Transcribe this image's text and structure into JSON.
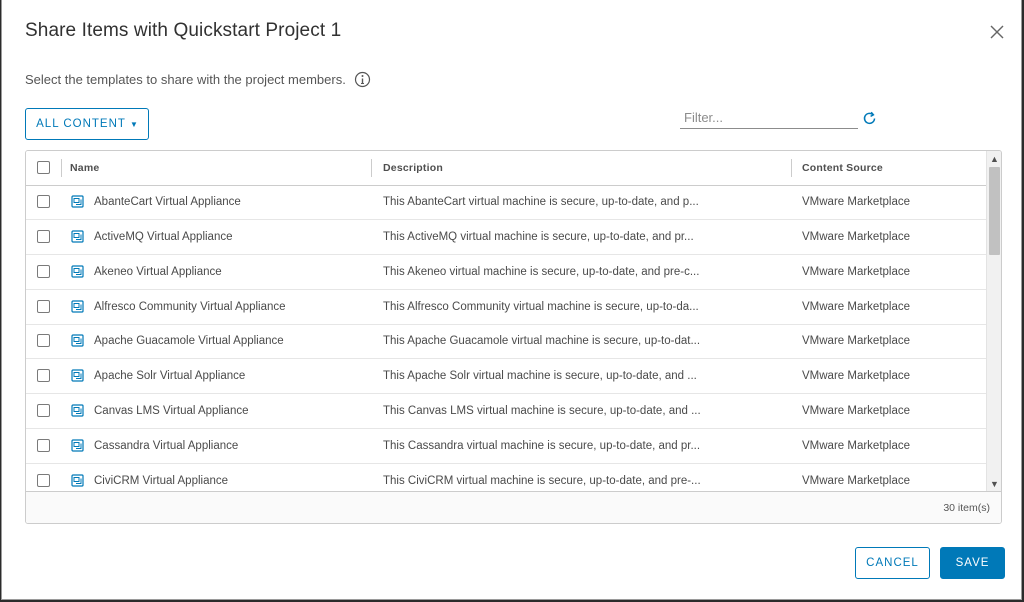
{
  "dialog": {
    "title": "Share Items with Quickstart Project 1",
    "subtitle": "Select the templates to share with the project members."
  },
  "toolbar": {
    "content_filter_label": "ALL CONTENT",
    "filter_placeholder": "Filter...",
    "filter_value": ""
  },
  "grid": {
    "columns": {
      "name": "Name",
      "description": "Description",
      "source": "Content Source"
    },
    "rows": [
      {
        "name": "AbanteCart Virtual Appliance",
        "description": "This AbanteCart virtual machine is secure, up-to-date, and p...",
        "source": "VMware Marketplace"
      },
      {
        "name": "ActiveMQ Virtual Appliance",
        "description": "This ActiveMQ virtual machine is secure, up-to-date, and pr...",
        "source": "VMware Marketplace"
      },
      {
        "name": "Akeneo Virtual Appliance",
        "description": "This Akeneo virtual machine is secure, up-to-date, and pre-c...",
        "source": "VMware Marketplace"
      },
      {
        "name": "Alfresco Community Virtual Appliance",
        "description": "This Alfresco Community virtual machine is secure, up-to-da...",
        "source": "VMware Marketplace"
      },
      {
        "name": "Apache Guacamole Virtual Appliance",
        "description": "This Apache Guacamole virtual machine is secure, up-to-dat...",
        "source": "VMware Marketplace"
      },
      {
        "name": "Apache Solr Virtual Appliance",
        "description": "This Apache Solr virtual machine is secure, up-to-date, and ...",
        "source": "VMware Marketplace"
      },
      {
        "name": "Canvas LMS Virtual Appliance",
        "description": "This Canvas LMS virtual machine is secure, up-to-date, and ...",
        "source": "VMware Marketplace"
      },
      {
        "name": "Cassandra Virtual Appliance",
        "description": "This Cassandra virtual machine is secure, up-to-date, and pr...",
        "source": "VMware Marketplace"
      },
      {
        "name": "CiviCRM Virtual Appliance",
        "description": "This CiviCRM virtual machine is secure, up-to-date, and pre-...",
        "source": "VMware Marketplace"
      }
    ],
    "footer_count": "30 item(s)"
  },
  "actions": {
    "cancel_label": "CANCEL",
    "save_label": "SAVE"
  },
  "colors": {
    "accent": "#0079b8",
    "text": "#313131",
    "border": "#cccccc"
  },
  "icons": {
    "close": "close-icon",
    "info": "info-icon",
    "refresh": "refresh-icon",
    "template": "vm-template-icon",
    "caret": "chevron-down-icon"
  }
}
